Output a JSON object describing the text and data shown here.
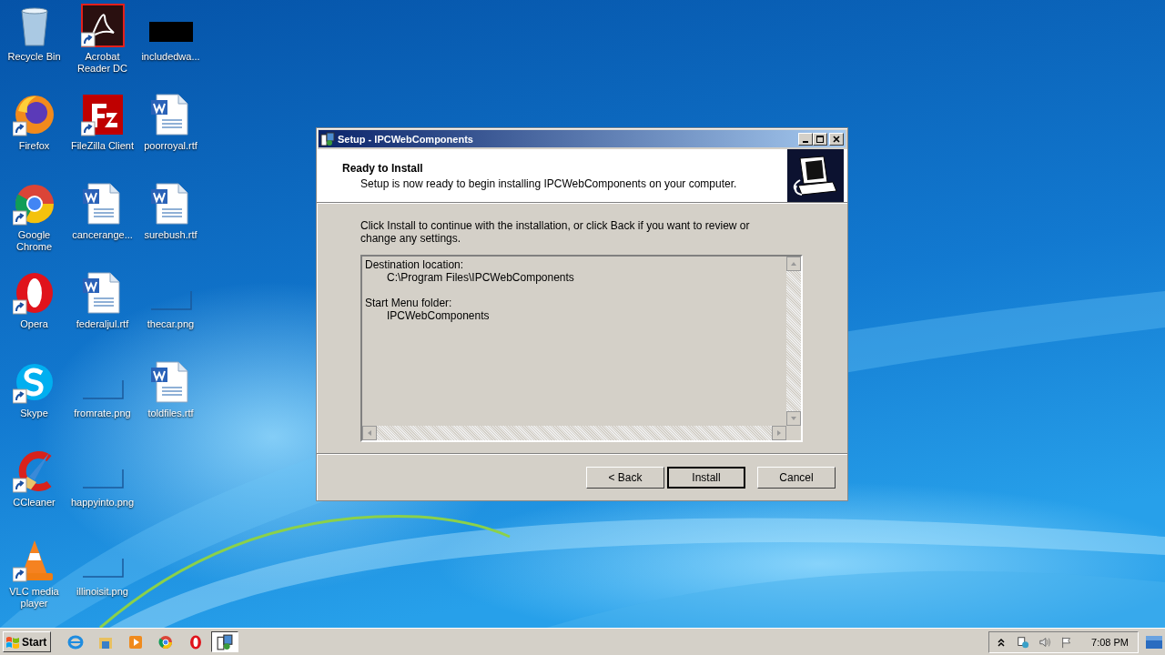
{
  "desktop": {
    "icons": [
      {
        "label": "Recycle Bin",
        "kind": "recycle",
        "shortcut": false
      },
      {
        "label": "Firefox",
        "kind": "firefox",
        "shortcut": true
      },
      {
        "label": "Google Chrome",
        "kind": "chrome",
        "shortcut": true
      },
      {
        "label": "Opera",
        "kind": "opera",
        "shortcut": true
      },
      {
        "label": "Skype",
        "kind": "skype",
        "shortcut": true
      },
      {
        "label": "CCleaner",
        "kind": "ccleaner",
        "shortcut": true
      },
      {
        "label": "VLC media player",
        "kind": "vlc",
        "shortcut": true
      },
      {
        "label": "Acrobat Reader DC",
        "kind": "acrobat",
        "shortcut": true
      },
      {
        "label": "FileZilla Client",
        "kind": "filezilla",
        "shortcut": true
      },
      {
        "label": "cancerange...",
        "kind": "word",
        "shortcut": false
      },
      {
        "label": "federaljul.rtf",
        "kind": "word",
        "shortcut": false
      },
      {
        "label": "fromrate.png",
        "kind": "png",
        "shortcut": false
      },
      {
        "label": "happyinto.png",
        "kind": "png",
        "shortcut": false
      },
      {
        "label": "illinoisit.png",
        "kind": "png",
        "shortcut": false
      },
      {
        "label": "includedwa...",
        "kind": "dark",
        "shortcut": false
      },
      {
        "label": "poorroyal.rtf",
        "kind": "word",
        "shortcut": false
      },
      {
        "label": "surebush.rtf",
        "kind": "word",
        "shortcut": false
      },
      {
        "label": "thecar.png",
        "kind": "png",
        "shortcut": false
      },
      {
        "label": "toldfiles.rtf",
        "kind": "word",
        "shortcut": false
      }
    ]
  },
  "dialog": {
    "title": "Setup - IPCWebComponents",
    "heading": "Ready to Install",
    "subheading": "Setup is now ready to begin installing IPCWebComponents on your computer.",
    "instruction": "Click Install to continue with the installation, or click Back if you want to review or change any settings.",
    "summary": [
      {
        "label": "Destination location:",
        "value": "C:\\Program Files\\IPCWebComponents"
      },
      {
        "label": "Start Menu folder:",
        "value": "IPCWebComponents"
      }
    ],
    "buttons": [
      {
        "label": "< Back",
        "default": false
      },
      {
        "label": "Install",
        "default": true
      },
      {
        "label": "Cancel",
        "default": false
      }
    ]
  },
  "taskbar": {
    "start": "Start",
    "quick_launch": [
      {
        "kind": "ie"
      },
      {
        "kind": "explorer"
      },
      {
        "kind": "media"
      },
      {
        "kind": "chrome"
      },
      {
        "kind": "opera"
      }
    ],
    "tasks": [
      {
        "kind": "setup",
        "selected": true
      }
    ],
    "time": "7:08 PM"
  }
}
